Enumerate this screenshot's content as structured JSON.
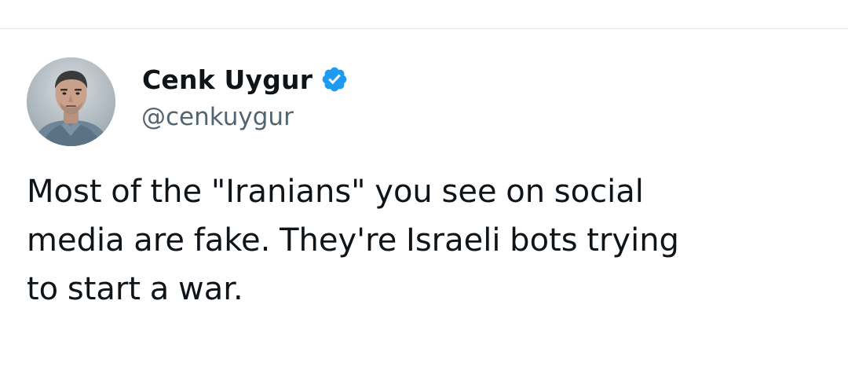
{
  "tweet": {
    "author": {
      "display_name": "Cenk Uygur",
      "handle": "@cenkuygur",
      "verified": true,
      "avatar_icon": "profile-photo",
      "verified_icon": "verified-badge-icon"
    },
    "text": "Most of the \"Iranians\" you see on social\nmedia are fake. They're Israeli bots trying\nto start a war."
  },
  "colors": {
    "text_primary": "#0f1419",
    "text_secondary": "#536471",
    "verified_blue": "#1d9bf0",
    "divider": "#e6e9ec",
    "background": "#ffffff"
  }
}
